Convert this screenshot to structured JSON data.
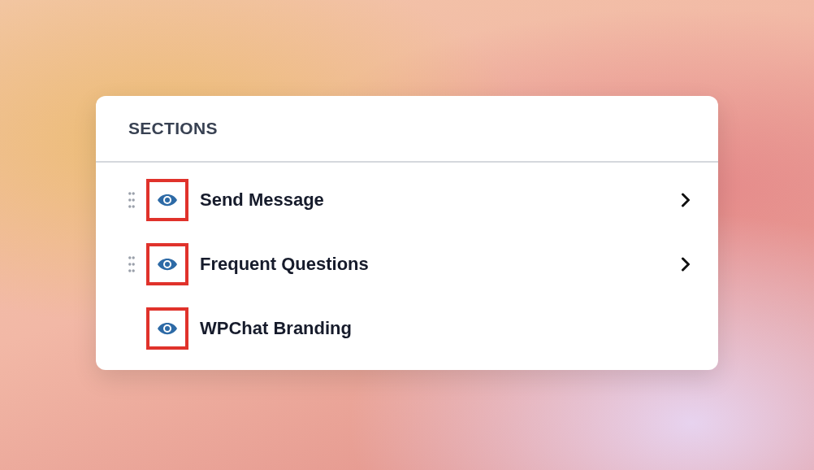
{
  "panel": {
    "title": "SECTIONS",
    "items": [
      {
        "label": "Send Message",
        "draggable": true,
        "expandable": true,
        "highlighted": true
      },
      {
        "label": "Frequent Questions",
        "draggable": true,
        "expandable": true,
        "highlighted": true
      },
      {
        "label": "WPChat Branding",
        "draggable": false,
        "expandable": false,
        "highlighted": true
      }
    ]
  }
}
